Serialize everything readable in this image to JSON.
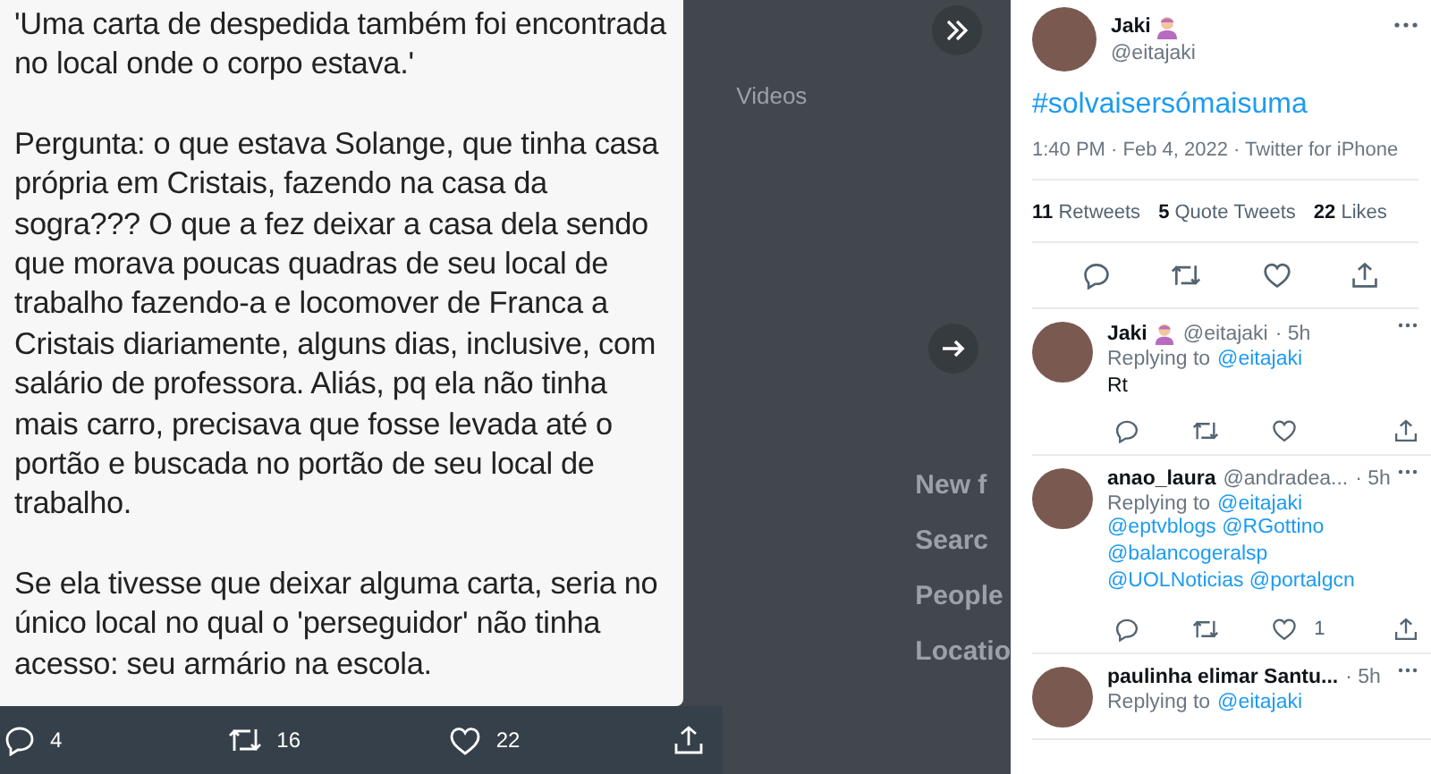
{
  "photo_tweet": {
    "paragraphs": [
      "'Uma carta de despedida também foi encontrada no local onde o corpo estava.'",
      "Pergunta: o que estava Solange, que tinha casa própria em Cristais, fazendo na casa da sogra??? O que a fez deixar a casa dela sendo que morava poucas quadras de seu local de trabalho fazendo-a e locomover de Franca a Cristais diariamente, alguns dias, inclusive, com salário de professora. Aliás, pq ela não tinha mais carro, precisava que fosse levada até o portão e buscada no portão de seu local de trabalho.",
      "Se ela tivesse que deixar alguma carta, seria no único local no qual o 'perseguidor' não tinha acesso: seu armário na escola."
    ],
    "actions": [
      {
        "kind": "reply",
        "count": "4"
      },
      {
        "kind": "retweet",
        "count": "16"
      },
      {
        "kind": "like",
        "count": "22"
      },
      {
        "kind": "share"
      }
    ]
  },
  "background": {
    "tab": "Videos",
    "texts": [
      "New f",
      "Searc",
      "People",
      "Locatio"
    ]
  },
  "main_tweet": {
    "name": "Jaki",
    "emoji": true,
    "handle": "@eitajaki",
    "text": "#solvaisersómaisuma",
    "meta": "1:40 PM · Feb 4, 2022 · Twitter for iPhone",
    "stats": [
      {
        "count": "11",
        "label": "Retweets"
      },
      {
        "count": "5",
        "label": "Quote Tweets"
      },
      {
        "count": "22",
        "label": "Likes"
      }
    ]
  },
  "replies": [
    {
      "name": "Jaki",
      "emoji": true,
      "handle": "@eitajaki",
      "time": "· 5h",
      "replying_label": "Replying to",
      "replying_to": [
        "@eitajaki"
      ],
      "text": "Rt"
    },
    {
      "name": "anao_laura",
      "emoji": false,
      "handle": "@andradea...",
      "time": "· 5h",
      "replying_label": "Replying to",
      "replying_to": [
        "@eitajaki"
      ],
      "mentions": "@eptvblogs @RGottino @balancogeralsp @UOLNoticias @portalgcn",
      "like_count": "1"
    },
    {
      "name": "paulinha elimar Santu...",
      "emoji": false,
      "time": "· 5h",
      "replying_label": "Replying to",
      "replying_to": [
        "@eitajaki"
      ]
    }
  ]
}
